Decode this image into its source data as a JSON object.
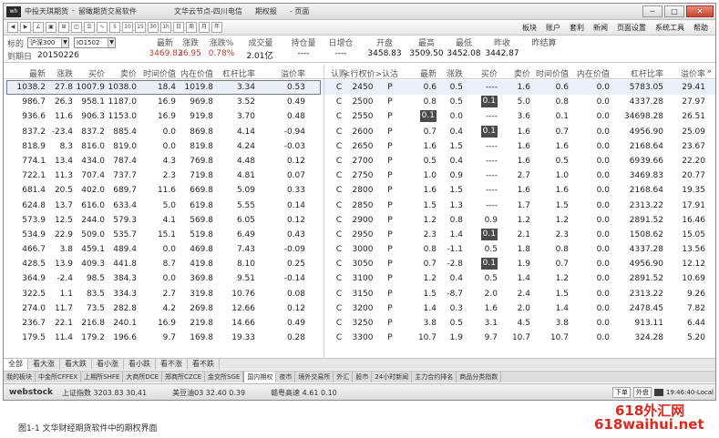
{
  "window": {
    "titles": [
      "中投天琪期货",
      "-",
      "留瞰期货交易软件"
    ],
    "title_items": [
      "文华云节点-四川电信",
      "期权报",
      "- 页面"
    ],
    "ctrl_min": "─",
    "ctrl_max": "□",
    "ctrl_close": "✕"
  },
  "toolbar": {
    "buttons": [
      "◀",
      "▶",
      "∠",
      "▣",
      "⊞",
      "◫",
      "☰",
      "∿",
      "5",
      "10",
      "15",
      "30",
      "1h",
      "日",
      "周",
      "月",
      "年"
    ],
    "menus": [
      "板块",
      "账户",
      "套利",
      "新闻",
      "页面设置",
      "系统工具",
      "帮助"
    ]
  },
  "info": {
    "label_underlying": "标的",
    "underlying": "沪深300",
    "contract": "IO1502",
    "label_expiry": "到期日",
    "expiry": "20150226",
    "heads": [
      "最新",
      "涨跌",
      "涨跌%",
      "成交量",
      "持仓量",
      "日增仓",
      "开盘",
      "最高",
      "最低",
      "昨收",
      "昨结算"
    ],
    "vals": [
      "3469.83",
      "26.95",
      "0.78%",
      "2.01亿",
      "----",
      "----",
      "3458.83",
      "3509.50",
      "3452.08",
      "3442.87",
      ""
    ]
  },
  "table": {
    "call_headers": [
      "最新",
      "涨跌",
      "买价",
      "卖价",
      "时间价值",
      "内在价值",
      "杠杆比率",
      "溢价率"
    ],
    "mid_headers": [
      "认购",
      "<行权价>",
      "认沽"
    ],
    "put_headers": [
      "最新",
      "涨跌",
      "买价",
      "卖价",
      "时间价值",
      "内在价值",
      "杠杆比率",
      "溢价率"
    ],
    "more": "»",
    "rows": [
      {
        "call": [
          "1038.2",
          "27.8",
          "1007.9",
          "1038.0",
          "18.4",
          "1019.8",
          "3.34",
          "0.53"
        ],
        "c": "C",
        "strike": "2450",
        "p": "P",
        "put": [
          "0.6",
          "0.5",
          "----",
          "1.6",
          "0.6",
          "0.0",
          "5783.05",
          "29.41"
        ]
      },
      {
        "call": [
          "986.7",
          "26.3",
          "958.1",
          "1187.0",
          "16.9",
          "969.8",
          "3.52",
          "0.49"
        ],
        "c": "C",
        "strike": "2500",
        "p": "P",
        "put": [
          "0.8",
          "0.5",
          "0.1",
          "5.0",
          "0.8",
          "0.0",
          "4337.28",
          "27.97"
        ]
      },
      {
        "call": [
          "936.6",
          "11.6",
          "906.3",
          "1153.0",
          "16.9",
          "919.8",
          "3.70",
          "0.48"
        ],
        "c": "C",
        "strike": "2550",
        "p": "P",
        "put": [
          "0.1",
          "0.0",
          "----",
          "3.6",
          "0.1",
          "0.0",
          "34698.28",
          "26.51"
        ]
      },
      {
        "call": [
          "837.2",
          "-23.4",
          "837.2",
          "885.4",
          "0.0",
          "869.8",
          "4.14",
          "-0.94"
        ],
        "c": "C",
        "strike": "2600",
        "p": "P",
        "put": [
          "0.7",
          "0.4",
          "0.1",
          "1.6",
          "0.7",
          "0.0",
          "4956.90",
          "25.09"
        ]
      },
      {
        "call": [
          "818.9",
          "8.3",
          "816.0",
          "819.0",
          "0.0",
          "819.8",
          "4.24",
          "-0.03"
        ],
        "c": "C",
        "strike": "2650",
        "p": "P",
        "put": [
          "1.6",
          "1.5",
          "----",
          "1.6",
          "1.6",
          "0.0",
          "2168.64",
          "23.67"
        ]
      },
      {
        "call": [
          "774.1",
          "13.4",
          "434.0",
          "787.4",
          "4.3",
          "769.8",
          "4.48",
          "0.12"
        ],
        "c": "C",
        "strike": "2700",
        "p": "P",
        "put": [
          "0.5",
          "0.4",
          "----",
          "1.6",
          "0.5",
          "0.0",
          "6939.66",
          "22.20"
        ]
      },
      {
        "call": [
          "722.1",
          "11.3",
          "707.4",
          "737.7",
          "2.3",
          "719.8",
          "4.81",
          "0.07"
        ],
        "c": "C",
        "strike": "2750",
        "p": "P",
        "put": [
          "1.0",
          "0.9",
          "----",
          "2.7",
          "1.0",
          "0.0",
          "3469.83",
          "20.77"
        ]
      },
      {
        "call": [
          "681.4",
          "20.5",
          "402.0",
          "689.7",
          "11.6",
          "669.8",
          "5.09",
          "0.33"
        ],
        "c": "C",
        "strike": "2800",
        "p": "P",
        "put": [
          "1.6",
          "1.5",
          "----",
          "1.6",
          "1.6",
          "0.0",
          "2168.64",
          "19.35"
        ]
      },
      {
        "call": [
          "624.8",
          "13.7",
          "616.0",
          "633.4",
          "5.0",
          "619.8",
          "5.55",
          "0.14"
        ],
        "c": "C",
        "strike": "2850",
        "p": "P",
        "put": [
          "1.5",
          "1.3",
          "----",
          "1.7",
          "1.5",
          "0.0",
          "2313.22",
          "17.91"
        ]
      },
      {
        "call": [
          "573.9",
          "12.5",
          "244.0",
          "579.3",
          "4.1",
          "569.8",
          "6.05",
          "0.12"
        ],
        "c": "C",
        "strike": "2900",
        "p": "P",
        "put": [
          "1.2",
          "0.8",
          "0.9",
          "1.2",
          "1.2",
          "0.0",
          "2891.52",
          "16.46"
        ]
      },
      {
        "call": [
          "534.9",
          "22.9",
          "509.0",
          "535.7",
          "15.1",
          "519.8",
          "6.49",
          "0.43"
        ],
        "c": "C",
        "strike": "2950",
        "p": "P",
        "put": [
          "2.3",
          "1.4",
          "0.1",
          "2.1",
          "2.3",
          "0.0",
          "1508.62",
          "15.05"
        ]
      },
      {
        "call": [
          "466.7",
          "3.8",
          "459.1",
          "489.4",
          "0.0",
          "469.8",
          "7.43",
          "-0.09"
        ],
        "c": "C",
        "strike": "3000",
        "p": "P",
        "put": [
          "0.8",
          "-1.1",
          "0.5",
          "1.8",
          "0.8",
          "0.0",
          "4337.28",
          "13.56"
        ]
      },
      {
        "call": [
          "428.5",
          "13.9",
          "409.3",
          "441.8",
          "8.7",
          "419.8",
          "8.10",
          "0.25"
        ],
        "c": "C",
        "strike": "3050",
        "p": "P",
        "put": [
          "0.7",
          "-2.8",
          "0.1",
          "1.9",
          "0.7",
          "0.0",
          "4956.90",
          "12.12"
        ]
      },
      {
        "call": [
          "364.9",
          "-2.4",
          "98.5",
          "384.3",
          "0.0",
          "369.8",
          "9.51",
          "-0.14"
        ],
        "c": "C",
        "strike": "3100",
        "p": "P",
        "put": [
          "1.2",
          "0.4",
          "0.5",
          "1.4",
          "1.2",
          "0.0",
          "2891.52",
          "10.69"
        ]
      },
      {
        "call": [
          "322.5",
          "1.1",
          "83.5",
          "334.3",
          "2.7",
          "319.8",
          "10.76",
          "0.08"
        ],
        "c": "C",
        "strike": "3150",
        "p": "P",
        "put": [
          "1.5",
          "-8.7",
          "2.0",
          "2.4",
          "1.5",
          "0.0",
          "2313.22",
          "9.26"
        ]
      },
      {
        "call": [
          "274.0",
          "11.7",
          "73.5",
          "282.8",
          "4.2",
          "269.8",
          "12.66",
          "0.12"
        ],
        "c": "C",
        "strike": "3200",
        "p": "P",
        "put": [
          "1.4",
          "0.3",
          "1.6",
          "2.0",
          "1.4",
          "0.0",
          "2478.45",
          "7.82"
        ]
      },
      {
        "call": [
          "236.7",
          "22.1",
          "216.8",
          "240.1",
          "16.9",
          "219.8",
          "14.66",
          "0.49"
        ],
        "c": "C",
        "strike": "3250",
        "p": "P",
        "put": [
          "3.8",
          "0.5",
          "3.1",
          "4.5",
          "3.8",
          "0.0",
          "913.11",
          "6.44"
        ]
      },
      {
        "call": [
          "179.5",
          "11.4",
          "179.2",
          "196.6",
          "9.7",
          "169.8",
          "19.33",
          "0.28"
        ],
        "c": "C",
        "strike": "3300",
        "p": "P",
        "put": [
          "10.7",
          "1.9",
          "9.7",
          "10.7",
          "10.7",
          "0.0",
          "324.28",
          "5.20"
        ]
      }
    ]
  },
  "tabs_view": [
    "全部",
    "看大涨",
    "看大跌",
    "看小涨",
    "看小跌",
    "看不涨",
    "看不跌"
  ],
  "tabs_market": [
    "我的板块",
    "中金所CFFEX",
    "上期所SHFE",
    "大商所DCE",
    "郑商所CZCE",
    "金交所SGE",
    "国内期权",
    "夜市",
    "境外交易所",
    "外汇",
    "股市",
    "24小时新闻",
    "主力合约排名",
    "商品分类指数"
  ],
  "status": {
    "brand": "webstock",
    "idx1": "上证指数 3203.83 30.41",
    "idx2": "美豆油03 32.40 0.39",
    "idx3": "赣粤高速 4.61 0.10",
    "btn1": "下单",
    "btn2": "外盘",
    "clock": "19:46:40-Local"
  },
  "caption": "图1-1 文华财经期货软件中的期权界面",
  "watermark": {
    "line1": "618外汇网",
    "line2": "618waihui.net"
  }
}
